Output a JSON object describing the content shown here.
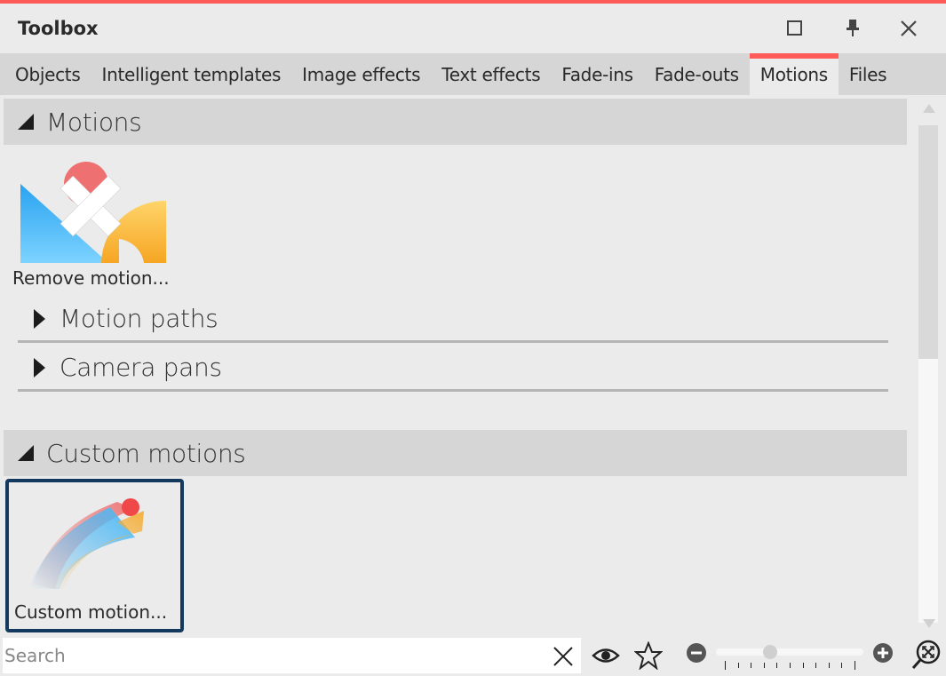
{
  "window": {
    "title": "Toolbox",
    "accent_color": "#ff5a5a",
    "controls": [
      {
        "name": "maximize",
        "icon": "square-icon"
      },
      {
        "name": "pin",
        "icon": "pin-icon"
      },
      {
        "name": "close",
        "icon": "close-icon"
      }
    ]
  },
  "tabs": [
    {
      "label": "Objects",
      "active": false
    },
    {
      "label": "Intelligent templates",
      "active": false
    },
    {
      "label": "Image effects",
      "active": false
    },
    {
      "label": "Text effects",
      "active": false
    },
    {
      "label": "Fade-ins",
      "active": false
    },
    {
      "label": "Fade-outs",
      "active": false
    },
    {
      "label": "Motions",
      "active": true
    },
    {
      "label": "Files",
      "active": false
    }
  ],
  "sections": [
    {
      "label": "Motions",
      "expanded": true,
      "items": [
        {
          "label": "Remove motion...",
          "icon": "remove-motion-icon"
        }
      ],
      "subgroups": [
        {
          "label": "Motion paths",
          "expanded": false
        },
        {
          "label": "Camera pans",
          "expanded": false
        }
      ]
    },
    {
      "label": "Custom motions",
      "expanded": true,
      "items": [
        {
          "label": "Custom motion...",
          "icon": "custom-motion-icon",
          "selected": true
        }
      ]
    }
  ],
  "bottombar": {
    "search_placeholder": "Search",
    "search_value": "",
    "zoom_slider_fraction": 0.35,
    "zoom_tick_count": 11
  }
}
